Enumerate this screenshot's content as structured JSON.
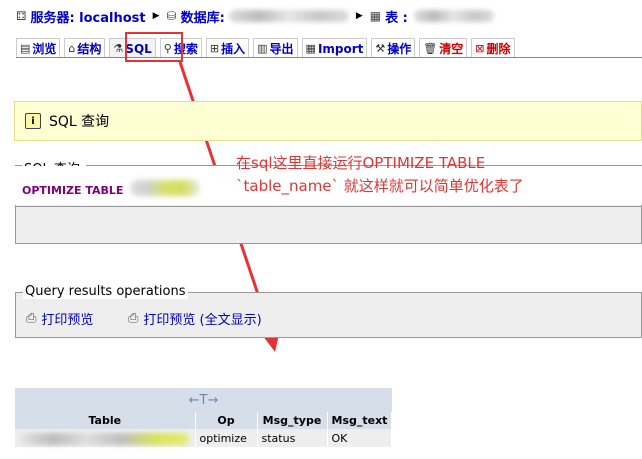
{
  "breadcrumb": {
    "server_label": "服务器: localhost",
    "database_label": "数据库:",
    "table_label": "表 :"
  },
  "tabs": [
    {
      "label": "浏览",
      "icon": "browse-icon"
    },
    {
      "label": "结构",
      "icon": "structure-icon"
    },
    {
      "label": "SQL",
      "icon": "sql-icon"
    },
    {
      "label": "搜索",
      "icon": "search-icon"
    },
    {
      "label": "插入",
      "icon": "insert-icon"
    },
    {
      "label": "导出",
      "icon": "export-icon"
    },
    {
      "label": "Import",
      "icon": "import-icon"
    },
    {
      "label": "操作",
      "icon": "operations-icon"
    },
    {
      "label": "清空",
      "icon": "empty-icon"
    },
    {
      "label": "删除",
      "icon": "drop-icon"
    }
  ],
  "notice": {
    "text": "SQL 查询"
  },
  "sql_query": {
    "legend": "SQL 查询:",
    "query_text": "OPTIMIZE TABLE"
  },
  "annotation": {
    "line1": "在sql这里直接运行OPTIMIZE TABLE",
    "line2": "`table_name` 就这样就可以简单优化表了"
  },
  "query_results": {
    "legend": "Query results operations",
    "print_view": "打印预览",
    "print_view_full": "打印预览 (全文显示)"
  },
  "results": {
    "nav_arrows": "←T→",
    "columns": [
      "Table",
      "Op",
      "Msg_type",
      "Msg_text"
    ],
    "rows": [
      {
        "op": "optimize",
        "msg_type": "status",
        "msg_text": "OK"
      }
    ]
  },
  "colors": {
    "link": "#0000cc",
    "annotation": "#e53333",
    "notice_bg": "#ffffd4",
    "table_header_bg": "#d6dee9"
  }
}
